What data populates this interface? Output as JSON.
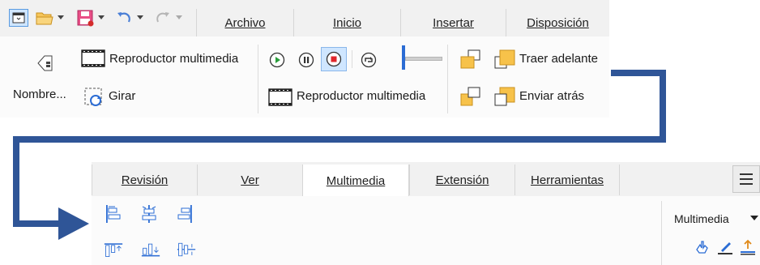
{
  "top_tabs": [
    {
      "label": "Archivo"
    },
    {
      "label": "Inicio"
    },
    {
      "label": "Insertar"
    },
    {
      "label": "Disposición"
    }
  ],
  "top_ribbon": {
    "name_button": "Nombre...",
    "media_player_1": "Reproductor multimedia",
    "rotate": "Girar",
    "media_player_2": "Reproductor multimedia",
    "bring_forward": "Traer adelante",
    "send_backward": "Enviar atrás"
  },
  "bottom_tabs": [
    {
      "label": "Revisión"
    },
    {
      "label": "Ver"
    },
    {
      "label": "Multimedia"
    },
    {
      "label": "Extensión"
    },
    {
      "label": "Herramientas"
    }
  ],
  "bottom_ribbon": {
    "dropdown_value": "Multimedia"
  },
  "colors": {
    "arrow": "#2f5597",
    "accent_blue": "#2b6cd4",
    "record_red": "#e0262b",
    "play_green": "#2a9d3b",
    "shape_orange": "#f5a623"
  },
  "icons": [
    "new-frame-icon",
    "open-folder-icon",
    "save-icon",
    "undo-icon",
    "redo-icon",
    "hamburger-menu-icon"
  ]
}
